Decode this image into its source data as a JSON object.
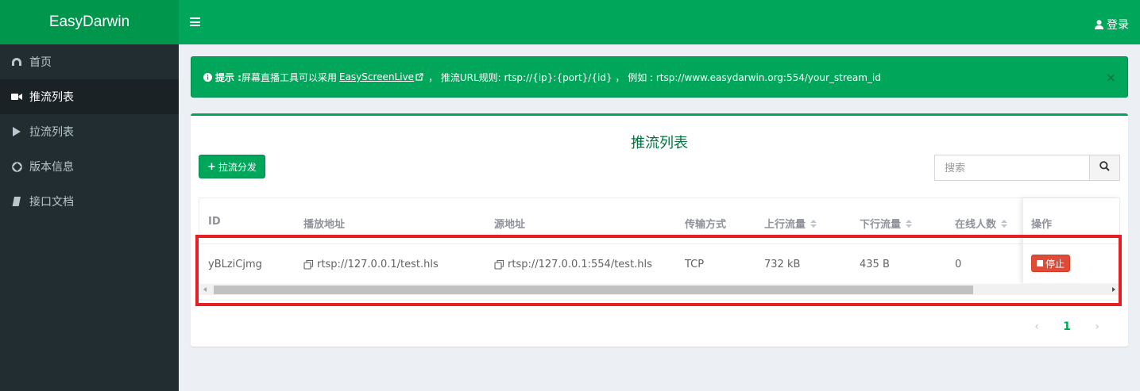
{
  "app": {
    "title": "EasyDarwin"
  },
  "sidebar": {
    "items": [
      {
        "label": "首页",
        "icon": "dashboard-icon"
      },
      {
        "label": "推流列表",
        "icon": "video-camera-icon",
        "active": true
      },
      {
        "label": "拉流列表",
        "icon": "play-icon"
      },
      {
        "label": "版本信息",
        "icon": "life-ring-icon"
      },
      {
        "label": "接口文档",
        "icon": "book-icon"
      }
    ]
  },
  "header": {
    "login_label": "登录"
  },
  "alert": {
    "prefix": "提示 : ",
    "text1": "屏幕直播工具可以采用",
    "link": "EasyScreenLive",
    "text2": "， 推流URL规则: rtsp://{ip}:{port}/{id} ， 例如 : rtsp://www.easydarwin.org:554/your_stream_id",
    "close": "×"
  },
  "main": {
    "title": "推流列表",
    "add_button": "拉流分发",
    "search_placeholder": "搜索"
  },
  "table": {
    "headers": [
      "ID",
      "播放地址",
      "源地址",
      "传输方式",
      "上行流量",
      "下行流量",
      "在线人数",
      "操作"
    ],
    "rows": [
      {
        "id": "yBLziCjmg",
        "play_url": "rtsp://127.0.0.1/test.hls",
        "source_url": "rtsp://127.0.0.1:554/test.hls",
        "transport": "TCP",
        "up": "732 kB",
        "down": "435 B",
        "online": "0",
        "action": "停止"
      }
    ]
  },
  "pagination": {
    "prev": "‹",
    "current": "1",
    "next": "›"
  },
  "colors": {
    "primary": "#00a65a",
    "sidebar": "#222d32",
    "danger": "#dd4b39",
    "highlight": "#e61f26"
  }
}
